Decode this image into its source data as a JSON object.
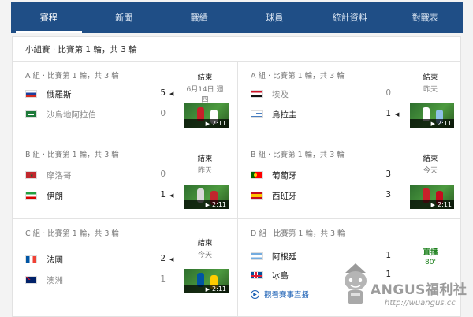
{
  "nav": {
    "tabs": [
      {
        "label": "賽程",
        "active": true
      },
      {
        "label": "新聞",
        "active": false
      },
      {
        "label": "戰績",
        "active": false
      },
      {
        "label": "球員",
        "active": false
      },
      {
        "label": "統計資料",
        "active": false
      },
      {
        "label": "對戰表",
        "active": false
      }
    ]
  },
  "section": {
    "title": "小組賽 · 比賽第 1 輪，共 3 輪"
  },
  "matches": [
    {
      "group": "A 組 · 比賽第 1 輪，共 3 輪",
      "team1": {
        "name": "俄羅斯",
        "score": "5",
        "flag": "russia-flag-icon"
      },
      "team2": {
        "name": "沙烏地阿拉伯",
        "score": "0",
        "flag": "saudi-arabia-flag-icon"
      },
      "status": "結束",
      "status_sub": "6月14日 週四",
      "duration": "2:11"
    },
    {
      "group": "A 組 · 比賽第 1 輪，共 3 輪",
      "team1": {
        "name": "埃及",
        "score": "0",
        "flag": "egypt-flag-icon"
      },
      "team2": {
        "name": "烏拉圭",
        "score": "1",
        "flag": "uruguay-flag-icon"
      },
      "status": "結束",
      "status_sub": "昨天",
      "duration": "2:11"
    },
    {
      "group": "B 組 · 比賽第 1 輪，共 3 輪",
      "team1": {
        "name": "摩洛哥",
        "score": "0",
        "flag": "morocco-flag-icon"
      },
      "team2": {
        "name": "伊朗",
        "score": "1",
        "flag": "iran-flag-icon"
      },
      "status": "結束",
      "status_sub": "昨天",
      "duration": "2:11"
    },
    {
      "group": "B 組 · 比賽第 1 輪，共 3 輪",
      "team1": {
        "name": "葡萄牙",
        "score": "3",
        "flag": "portugal-flag-icon"
      },
      "team2": {
        "name": "西班牙",
        "score": "3",
        "flag": "spain-flag-icon"
      },
      "status": "結束",
      "status_sub": "今天",
      "duration": "2:11"
    },
    {
      "group": "C 組 · 比賽第 1 輪，共 3 輪",
      "team1": {
        "name": "法國",
        "score": "2",
        "flag": "france-flag-icon"
      },
      "team2": {
        "name": "澳洲",
        "score": "1",
        "flag": "australia-flag-icon"
      },
      "status": "結束",
      "status_sub": "今天",
      "duration": "2:11"
    },
    {
      "group": "D 組 · 比賽第 1 輪，共 3 輪",
      "team1": {
        "name": "阿根廷",
        "score": "1",
        "flag": "argentina-flag-icon"
      },
      "team2": {
        "name": "冰島",
        "score": "1",
        "flag": "iceland-flag-icon"
      },
      "status": "直播",
      "status_sub": "80'",
      "watch_label": "觀看賽事直播"
    }
  ],
  "watermark": {
    "brand": "ANGUS福利社",
    "url": "http://wuangus.cc"
  },
  "colors": {
    "nav_bg": "#1f4e86",
    "live": "#1a7f1a",
    "link": "#1a5fb4"
  }
}
